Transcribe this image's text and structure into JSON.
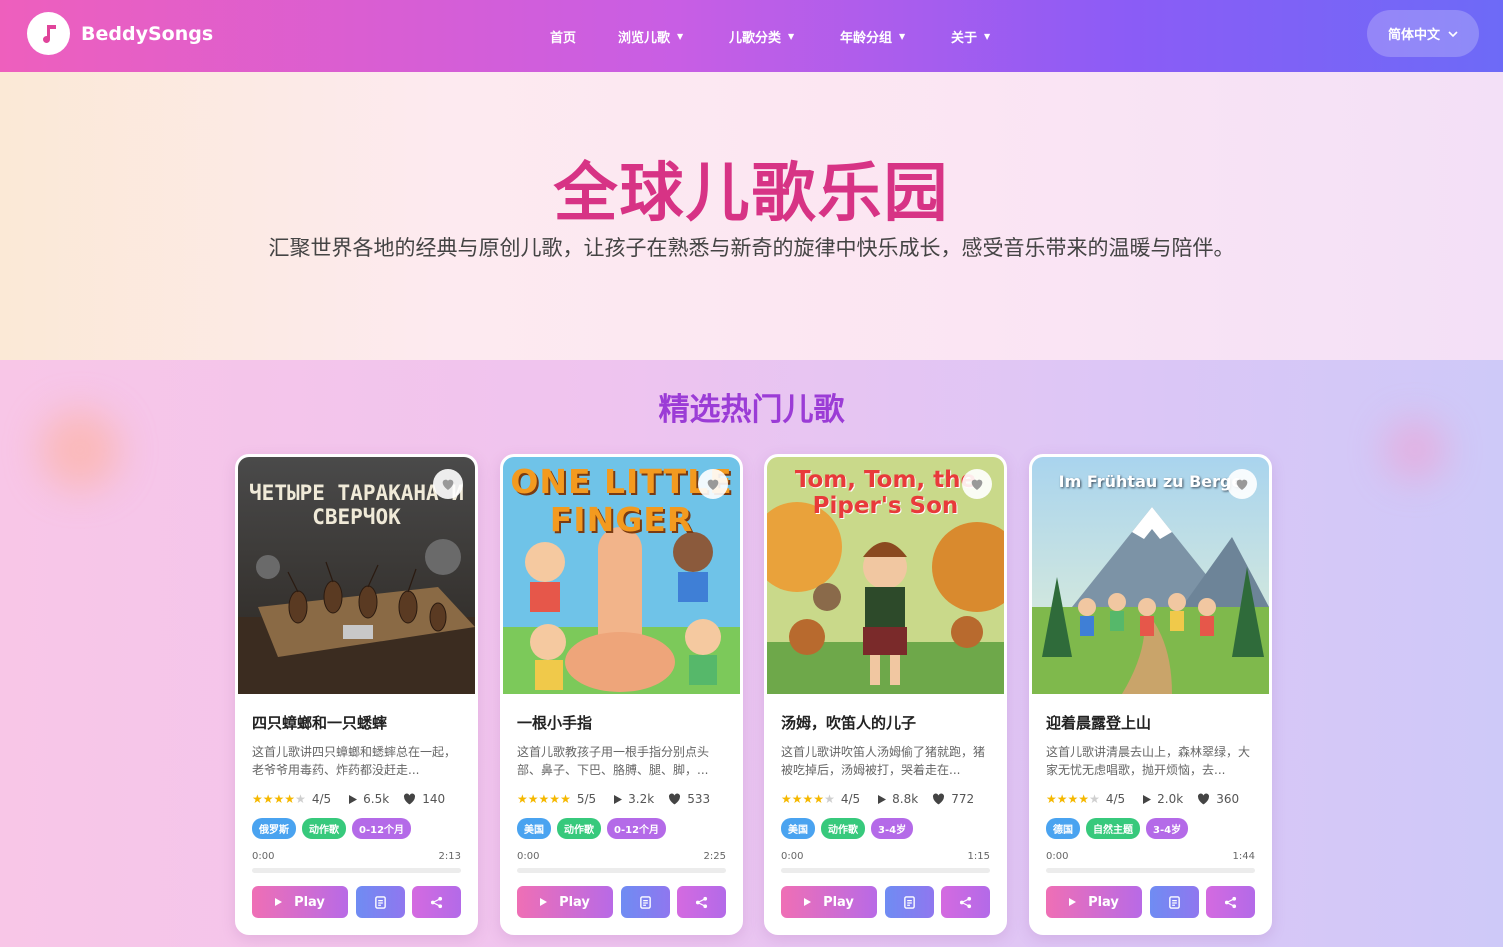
{
  "brand": {
    "name": "BeddySongs",
    "accent": "#e0449b"
  },
  "nav": {
    "items": [
      {
        "label": "首页",
        "dropdown": false
      },
      {
        "label": "浏览儿歌",
        "dropdown": true
      },
      {
        "label": "儿歌分类",
        "dropdown": true
      },
      {
        "label": "年龄分组",
        "dropdown": true
      },
      {
        "label": "关于",
        "dropdown": true
      }
    ],
    "language": "简体中文"
  },
  "hero": {
    "title": "全球儿歌乐园",
    "subtitle": "汇聚世界各地的经典与原创儿歌，让孩子在熟悉与新奇的旋律中快乐成长，感受音乐带来的温暖与陪伴。"
  },
  "featured": {
    "heading": "精选热门儿歌",
    "play_label": "Play",
    "songs": [
      {
        "cover_text": "ЧЕТЫРЕ ТАРАКАНА И СВЕРЧОК",
        "title": "四只蟑螂和一只蟋蟀",
        "description": "这首儿歌讲四只蟑螂和蟋蟀总在一起，老爷爷用毒药、炸药都没赶走...",
        "stars": 4,
        "rating": "4/5",
        "plays": "6.5k",
        "likes": "140",
        "tags": [
          {
            "label": "俄罗斯",
            "color": "blue"
          },
          {
            "label": "动作歌",
            "color": "green"
          },
          {
            "label": "0-12个月",
            "color": "purple"
          }
        ],
        "time_current": "0:00",
        "time_total": "2:13",
        "progress": 0
      },
      {
        "cover_text": "ONE LITTLE FINGER",
        "title": "一根小手指",
        "description": "这首儿歌教孩子用一根手指分别点头部、鼻子、下巴、胳膊、腿、脚，...",
        "stars": 5,
        "rating": "5/5",
        "plays": "3.2k",
        "likes": "533",
        "tags": [
          {
            "label": "美国",
            "color": "blue"
          },
          {
            "label": "动作歌",
            "color": "green"
          },
          {
            "label": "0-12个月",
            "color": "purple"
          }
        ],
        "time_current": "0:00",
        "time_total": "2:25",
        "progress": 0
      },
      {
        "cover_text": "Tom, Tom, the Piper's Son",
        "title": "汤姆，吹笛人的儿子",
        "description": "这首儿歌讲吹笛人汤姆偷了猪就跑，猪被吃掉后，汤姆被打，哭着走在...",
        "stars": 4,
        "rating": "4/5",
        "plays": "8.8k",
        "likes": "772",
        "tags": [
          {
            "label": "美国",
            "color": "blue"
          },
          {
            "label": "动作歌",
            "color": "green"
          },
          {
            "label": "3-4岁",
            "color": "purple"
          }
        ],
        "time_current": "0:00",
        "time_total": "1:15",
        "progress": 0
      },
      {
        "cover_text": "Im Frühtau zu Berge",
        "title": "迎着晨露登上山",
        "description": "这首儿歌讲清晨去山上，森林翠绿，大家无忧无虑唱歌，抛开烦恼，去...",
        "stars": 4,
        "rating": "4/5",
        "plays": "2.0k",
        "likes": "360",
        "tags": [
          {
            "label": "德国",
            "color": "blue"
          },
          {
            "label": "自然主题",
            "color": "green"
          },
          {
            "label": "3-4岁",
            "color": "purple"
          }
        ],
        "time_current": "0:00",
        "time_total": "1:44",
        "progress": 0
      }
    ]
  }
}
